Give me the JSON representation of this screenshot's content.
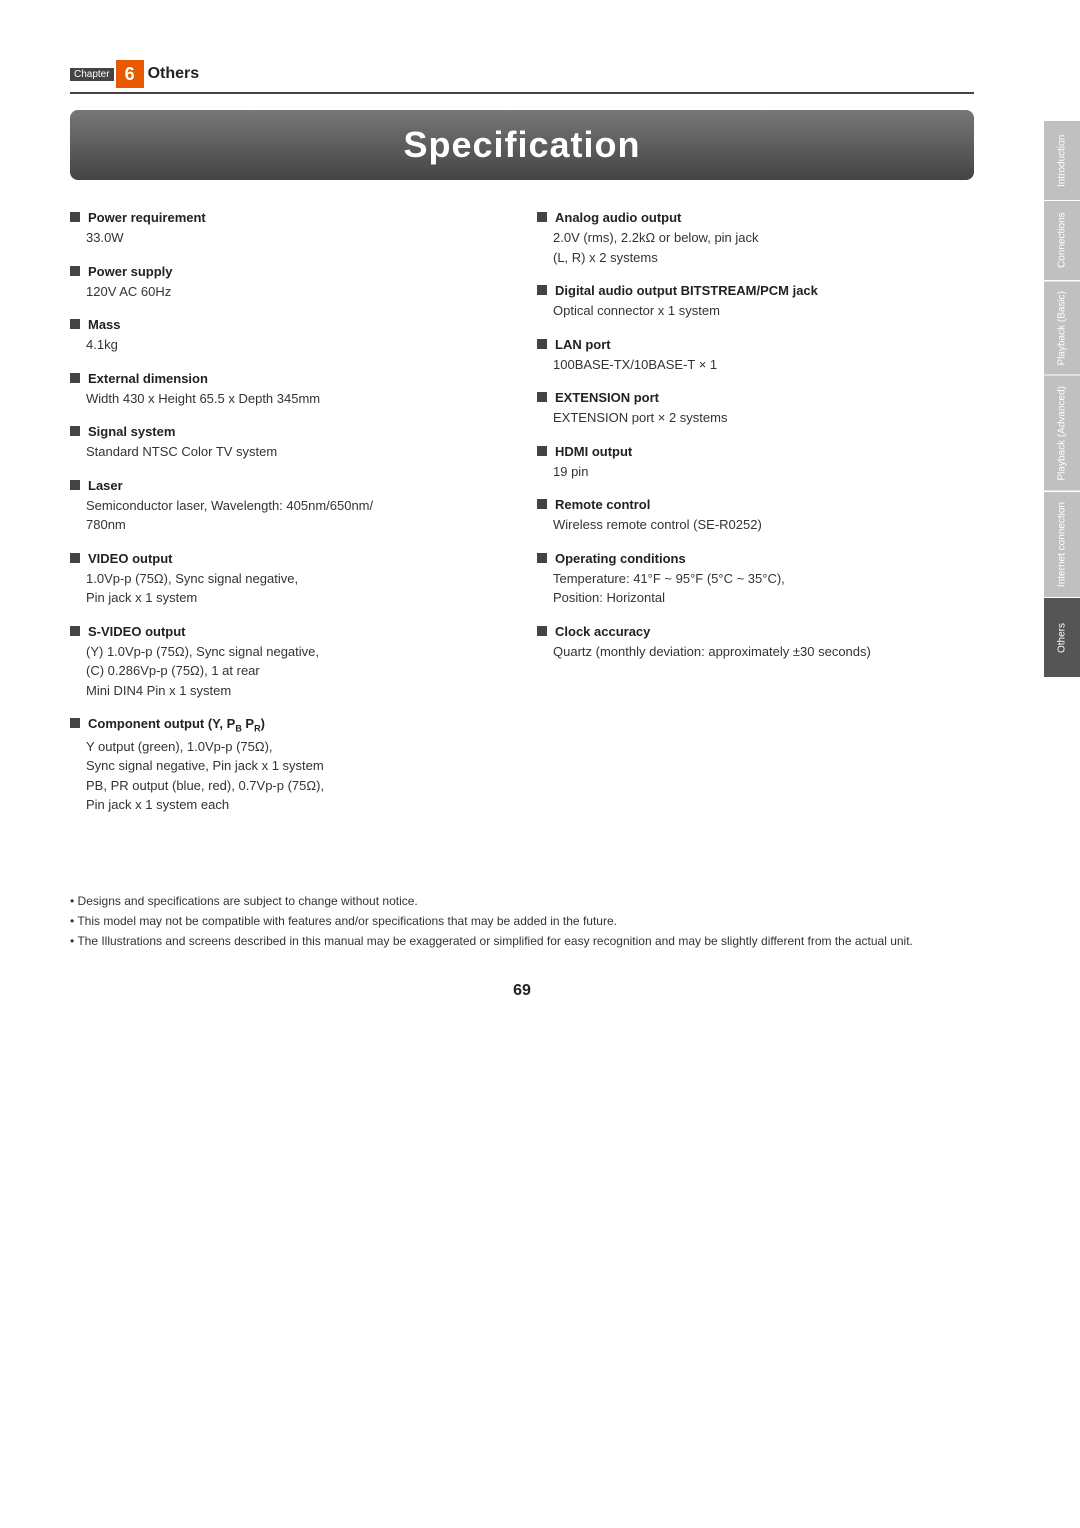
{
  "sidebar": {
    "tabs": [
      {
        "label": "Introduction",
        "active": false
      },
      {
        "label": "Connections",
        "active": false
      },
      {
        "label": "Playback (Basic)",
        "active": false
      },
      {
        "label": "Playback (Advanced)",
        "active": false
      },
      {
        "label": "Internet connection",
        "active": false
      },
      {
        "label": "Others",
        "active": true
      }
    ]
  },
  "chapter": {
    "prefix": "Chapter",
    "number": "6",
    "title": "Others"
  },
  "page_title": "Specification",
  "left_specs": [
    {
      "label": "Power requirement",
      "value": "33.0W"
    },
    {
      "label": "Power supply",
      "value": "120V AC 60Hz"
    },
    {
      "label": "Mass",
      "value": "4.1kg"
    },
    {
      "label": "External dimension",
      "value": "Width 430 x Height 65.5 x Depth 345mm"
    },
    {
      "label": "Signal system",
      "value": "Standard NTSC Color TV system"
    },
    {
      "label": "Laser",
      "value": "Semiconductor laser, Wavelength: 405nm/650nm/\n780nm"
    },
    {
      "label": "VIDEO output",
      "value": "1.0Vp-p (75Ω), Sync signal negative,\nPin jack x 1 system"
    },
    {
      "label": "S-VIDEO output",
      "value": "(Y) 1.0Vp-p (75Ω), Sync signal negative,\n(C) 0.286Vp-p (75Ω), 1 at rear\nMini DIN4 Pin x 1 system"
    },
    {
      "label": "Component output (Y, PB PR)",
      "value": "Y output (green), 1.0Vp-p (75Ω),\nSync signal negative, Pin jack x 1 system\nPB, PR output (blue, red), 0.7Vp-p (75Ω),\nPin jack x 1 system each"
    }
  ],
  "right_specs": [
    {
      "label": "Analog audio output",
      "value": "2.0V (rms), 2.2kΩ or below, pin jack\n(L, R) x 2 systems"
    },
    {
      "label": "Digital audio output BITSTREAM/PCM jack",
      "value": "Optical connector x 1 system"
    },
    {
      "label": "LAN port",
      "value": "100BASE-TX/10BASE-T × 1"
    },
    {
      "label": "EXTENSION port",
      "value": "EXTENSION port × 2 systems"
    },
    {
      "label": "HDMI output",
      "value": "19 pin"
    },
    {
      "label": "Remote control",
      "value": "Wireless remote control (SE-R0252)"
    },
    {
      "label": "Operating conditions",
      "value": "Temperature: 41°F ~ 95°F (5°C ~ 35°C),\nPosition: Horizontal"
    },
    {
      "label": "Clock accuracy",
      "value": "Quartz (monthly deviation: approximately ±30 seconds)"
    }
  ],
  "footer_notes": [
    "Designs and specifications are subject to change without notice.",
    "This model may not be compatible with features and/or specifications that may be added in the future.",
    "The Illustrations and screens described in this manual may be exaggerated or simplified for easy recognition and may be slightly different from the actual unit."
  ],
  "page_number": "69"
}
